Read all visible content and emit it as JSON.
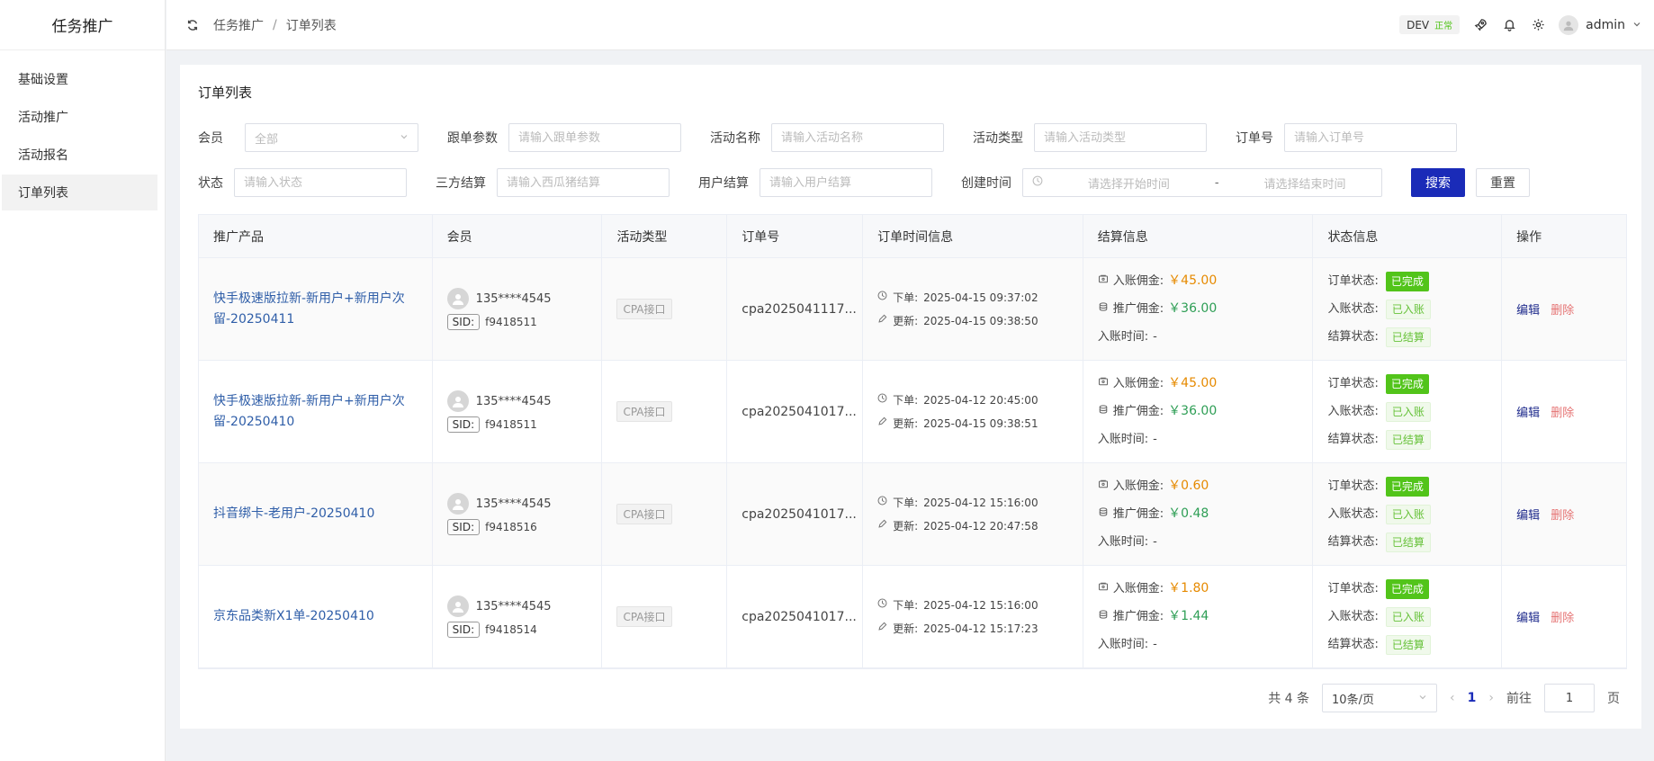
{
  "app": {
    "brand": "任务推广"
  },
  "sidebar": {
    "items": [
      {
        "label": "基础设置"
      },
      {
        "label": "活动推广"
      },
      {
        "label": "活动报名"
      },
      {
        "label": "订单列表"
      }
    ]
  },
  "header": {
    "breadcrumb": [
      "任务推广",
      "订单列表"
    ],
    "env_label": "DEV",
    "env_status": "正常",
    "user": "admin"
  },
  "page": {
    "title": "订单列表"
  },
  "filters": {
    "member_label": "会员",
    "member_value": "全部",
    "track_label": "跟单参数",
    "track_placeholder": "请输入跟单参数",
    "activity_name_label": "活动名称",
    "activity_name_placeholder": "请输入活动名称",
    "activity_type_label": "活动类型",
    "activity_type_placeholder": "请输入活动类型",
    "order_no_label": "订单号",
    "order_no_placeholder": "请输入订单号",
    "status_label": "状态",
    "status_placeholder": "请输入状态",
    "third_settle_label": "三方结算",
    "third_settle_placeholder": "请输入西瓜猪结算",
    "user_settle_label": "用户结算",
    "user_settle_placeholder": "请输入用户结算",
    "created_label": "创建时间",
    "start_placeholder": "请选择开始时间",
    "range_sep": "-",
    "end_placeholder": "请选择结束时间",
    "search_btn": "搜索",
    "reset_btn": "重置"
  },
  "table": {
    "headers": [
      "推广产品",
      "会员",
      "活动类型",
      "订单号",
      "订单时间信息",
      "结算信息",
      "状态信息",
      "操作"
    ],
    "labels": {
      "sid": "SID:",
      "placed": "下单:",
      "updated": "更新:",
      "income_commission": "入账佣金:",
      "promo_commission": "推广佣金:",
      "income_time": "入账时间:",
      "order_status": "订单状态:",
      "income_status": "入账状态:",
      "settle_status": "结算状态:",
      "edit": "编辑",
      "delete": "删除"
    },
    "rows": [
      {
        "product": "快手极速版拉新-新用户+新用户次留-20250411",
        "phone": "135****4545",
        "sid": "f9418511",
        "type": "CPA接口",
        "order_no": "cpa2025041117...",
        "placed_time": "2025-04-15 09:37:02",
        "updated_time": "2025-04-15 09:38:50",
        "income_commission": "￥45.00",
        "promo_commission": "￥36.00",
        "income_time": "-",
        "order_status": "已完成",
        "income_status": "已入账",
        "settle_status": "已结算"
      },
      {
        "product": "快手极速版拉新-新用户+新用户次留-20250410",
        "phone": "135****4545",
        "sid": "f9418511",
        "type": "CPA接口",
        "order_no": "cpa2025041017...",
        "placed_time": "2025-04-12 20:45:00",
        "updated_time": "2025-04-15 09:38:51",
        "income_commission": "￥45.00",
        "promo_commission": "￥36.00",
        "income_time": "-",
        "order_status": "已完成",
        "income_status": "已入账",
        "settle_status": "已结算"
      },
      {
        "product": "抖音绑卡-老用户-20250410",
        "phone": "135****4545",
        "sid": "f9418516",
        "type": "CPA接口",
        "order_no": "cpa2025041017...",
        "placed_time": "2025-04-12 15:16:00",
        "updated_time": "2025-04-12 20:47:58",
        "income_commission": "￥0.60",
        "promo_commission": "￥0.48",
        "income_time": "-",
        "order_status": "已完成",
        "income_status": "已入账",
        "settle_status": "已结算"
      },
      {
        "product": "京东品类新X1单-20250410",
        "phone": "135****4545",
        "sid": "f9418514",
        "type": "CPA接口",
        "order_no": "cpa2025041017...",
        "placed_time": "2025-04-12 15:16:00",
        "updated_time": "2025-04-12 15:17:23",
        "income_commission": "￥1.80",
        "promo_commission": "￥1.44",
        "income_time": "-",
        "order_status": "已完成",
        "income_status": "已入账",
        "settle_status": "已结算"
      }
    ]
  },
  "pagination": {
    "total": "共 4 条",
    "page_size": "10条/页",
    "current": "1",
    "goto_label": "前往",
    "goto_value": "1",
    "page_suffix": "页"
  },
  "colors": {
    "primary": "#1a2bb8",
    "success": "#52c41a",
    "link": "#2f5ea8",
    "danger": "#e57373",
    "amount_orange": "#e68a00",
    "amount_green": "#2e9e55"
  }
}
